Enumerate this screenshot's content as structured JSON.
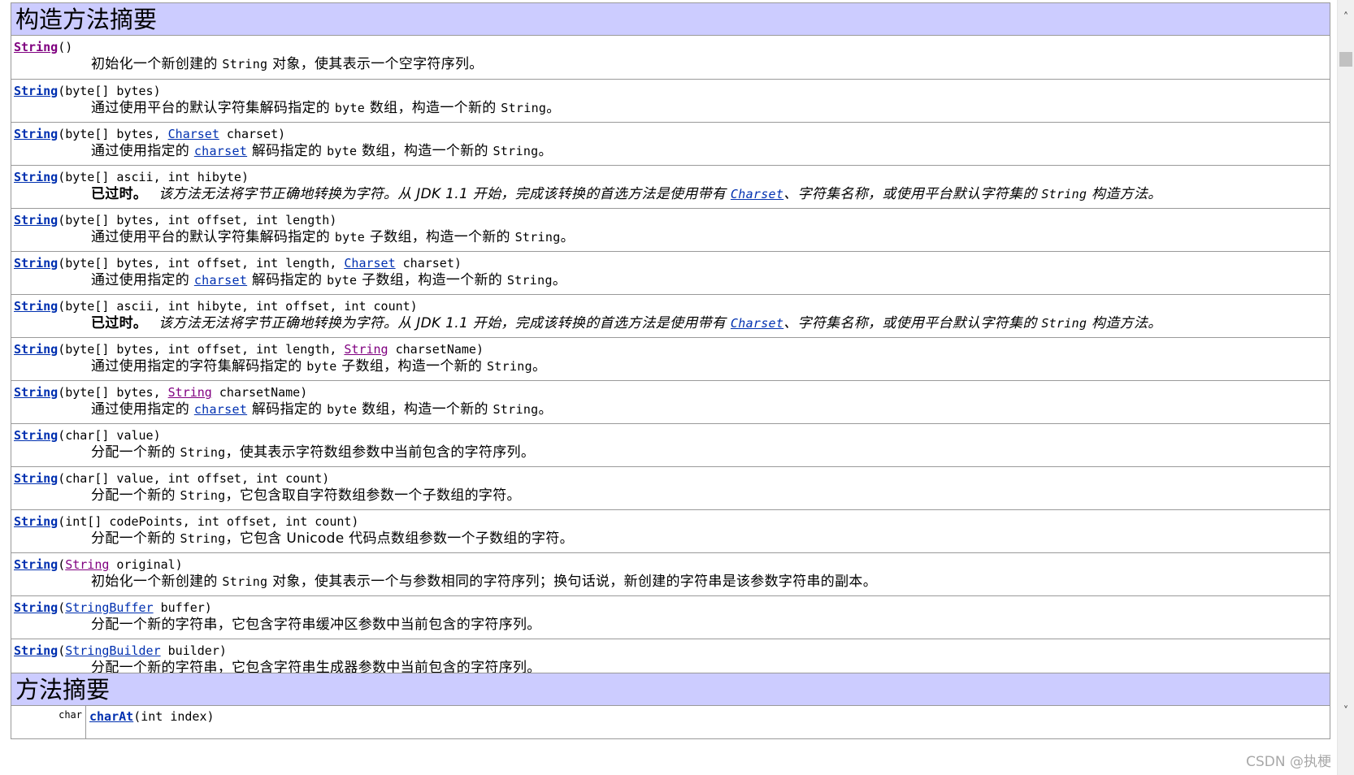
{
  "constructor_summary": {
    "title": "构造方法摘要",
    "rows": [
      {
        "name": "String",
        "params": "()",
        "desc_pre": "初始化一个新创建的 ",
        "desc_code": "String",
        "desc_post": " 对象，使其表示一个空字符序列。"
      },
      {
        "name": "String",
        "params": "(byte[] bytes)",
        "desc_pre": "通过使用平台的默认字符集解码指定的 ",
        "desc_code": "byte",
        "desc_post": " 数组，构造一个新的 ",
        "desc_code2": "String",
        "desc_post2": "。"
      },
      {
        "name": "String",
        "params_pre": "(byte[] bytes, ",
        "param_link": "Charset",
        "params_post": " charset)",
        "desc_pre": "通过使用指定的 ",
        "desc_link": "charset",
        "desc_post": " 解码指定的 ",
        "desc_code": "byte",
        "desc_post2": " 数组，构造一个新的 ",
        "desc_code2": "String",
        "desc_post3": "。"
      },
      {
        "name": "String",
        "params": "(byte[] ascii, int hibyte)",
        "deprecated_label": "已过时。",
        "desc_pre": "该方法无法将字节正确地转换为字符。从 JDK 1.1 开始，完成该转换的首选方法是使用带有 ",
        "desc_link": "Charset",
        "desc_post": "、字符集名称，或使用平台默认字符集的 ",
        "desc_code": "String",
        "desc_post2": " 构造方法。"
      },
      {
        "name": "String",
        "params": "(byte[] bytes, int offset, int length)",
        "desc_pre": "通过使用平台的默认字符集解码指定的 ",
        "desc_code": "byte",
        "desc_post": " 子数组，构造一个新的 ",
        "desc_code2": "String",
        "desc_post2": "。"
      },
      {
        "name": "String",
        "params_pre": "(byte[] bytes, int offset, int length, ",
        "param_link": "Charset",
        "params_post": " charset)",
        "desc_pre": "通过使用指定的 ",
        "desc_link": "charset",
        "desc_post": " 解码指定的 ",
        "desc_code": "byte",
        "desc_post2": " 子数组，构造一个新的 ",
        "desc_code2": "String",
        "desc_post3": "。"
      },
      {
        "name": "String",
        "params": "(byte[] ascii, int hibyte, int offset, int count)",
        "deprecated_label": "已过时。",
        "desc_pre": "该方法无法将字节正确地转换为字符。从 JDK 1.1 开始，完成该转换的首选方法是使用带有 ",
        "desc_link": "Charset",
        "desc_post": "、字符集名称，或使用平台默认字符集的 ",
        "desc_code": "String",
        "desc_post2": " 构造方法。"
      },
      {
        "name": "String",
        "params_pre": "(byte[] bytes, int offset, int length, ",
        "param_link": "String",
        "params_post": " charsetName)",
        "desc_pre": "通过使用指定的字符集解码指定的 ",
        "desc_code": "byte",
        "desc_post": " 子数组，构造一个新的 ",
        "desc_code2": "String",
        "desc_post2": "。"
      },
      {
        "name": "String",
        "params_pre": "(byte[] bytes, ",
        "param_link": "String",
        "params_post": " charsetName)",
        "desc_pre": "通过使用指定的 ",
        "desc_link": "charset",
        "desc_post": " 解码指定的 ",
        "desc_code": "byte",
        "desc_post2": " 数组，构造一个新的 ",
        "desc_code2": "String",
        "desc_post3": "。"
      },
      {
        "name": "String",
        "params": "(char[] value)",
        "desc_pre": "分配一个新的 ",
        "desc_code": "String",
        "desc_post": "，使其表示字符数组参数中当前包含的字符序列。"
      },
      {
        "name": "String",
        "params": "(char[] value, int offset, int count)",
        "desc_pre": "分配一个新的 ",
        "desc_code": "String",
        "desc_post": "，它包含取自字符数组参数一个子数组的字符。"
      },
      {
        "name": "String",
        "params": "(int[] codePoints, int offset, int count)",
        "desc_pre": "分配一个新的 ",
        "desc_code": "String",
        "desc_post": "，它包含 Unicode 代码点数组参数一个子数组的字符。"
      },
      {
        "name": "String",
        "params_pre": "(",
        "param_link": "String",
        "params_post": " original)",
        "desc_pre": "初始化一个新创建的 ",
        "desc_code": "String",
        "desc_post": " 对象，使其表示一个与参数相同的字符序列；换句话说，新创建的字符串是该参数字符串的副本。"
      },
      {
        "name": "String",
        "params_pre": "(",
        "param_link": "StringBuffer",
        "params_post": " buffer)",
        "desc_pre": "分配一个新的字符串，它包含字符串缓冲区参数中当前包含的字符序列。"
      },
      {
        "name": "String",
        "params_pre": "(",
        "param_link": "StringBuilder",
        "params_post": " builder)",
        "desc_pre": "分配一个新的字符串，它包含字符串生成器参数中当前包含的字符序列。"
      }
    ]
  },
  "method_summary": {
    "title": "方法摘要",
    "first_row": {
      "return_type": "char",
      "name": "charAt",
      "params": "(int index)"
    }
  },
  "watermark": "CSDN @执梗",
  "colors": {
    "header_bg": "#ccccff",
    "link": "#0030b0",
    "visited_link": "#800080",
    "border": "#9a9a9a"
  },
  "icons": {
    "scroll_up": "chevron-up-icon",
    "scroll_down": "chevron-down-icon"
  }
}
